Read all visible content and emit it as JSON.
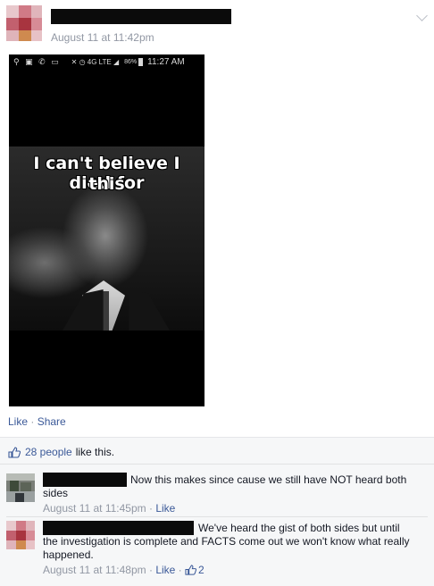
{
  "post": {
    "timestamp": "August 11 at 11:42pm",
    "status_bar": {
      "icons_left": "⚲ ▣ ✆ ▭",
      "icons_mid": "✕ ◷ 4G LTE ◢",
      "battery": "86%",
      "time": "11:27 AM"
    },
    "meme_text_line1": "I can't believe I died for",
    "meme_text_line2": "this"
  },
  "actions": {
    "like": "Like",
    "share": "Share"
  },
  "likes": {
    "count_text": "28 people",
    "suffix": "like this."
  },
  "comments": [
    {
      "text_line1": "Now this makes since cause we still have NOT heard both",
      "text_line2": "sides",
      "timestamp": "August 11 at 11:45pm",
      "like": "Like"
    },
    {
      "text_line1": "We've heard the gist of both sides but until",
      "text_line2": "the investigation is complete and FACTS come out we won't know what really",
      "text_line3": "happened.",
      "timestamp": "August 11 at 11:48pm",
      "like": "Like",
      "like_count": "2"
    }
  ],
  "colors": {
    "link": "#3b5998",
    "meta": "#9197a3"
  },
  "icons": [
    "chevron-down-icon",
    "thumbs-up-icon"
  ]
}
